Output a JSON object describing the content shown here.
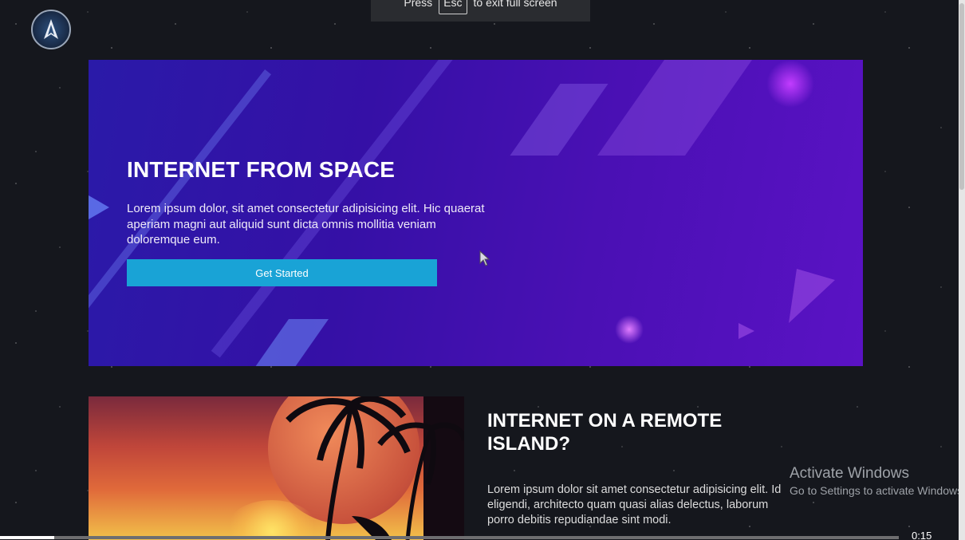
{
  "overlay": {
    "press": "Press",
    "key": "Esc",
    "suffix": "to exit full screen"
  },
  "logo_icon": "shield-rocket-logo",
  "hero": {
    "title": "INTERNET FROM SPACE",
    "text": "Lorem ipsum dolor, sit amet consectetur adipisicing elit. Hic quaerat aperiam magni aut aliquid sunt dicta omnis mollitia veniam doloremque eum.",
    "cta_label": "Get Started",
    "cta_color": "#19a3d6"
  },
  "section": {
    "title": "INTERNET ON A REMOTE ISLAND?",
    "text": "Lorem ipsum dolor sit amet consectetur adipisicing elit. Id eligendi, architecto quam quasi alias delectus, laborum porro debitis repudiandae sint modi."
  },
  "watermark": {
    "line1": "Activate Windows",
    "line2": "Go to Settings to activate Windows."
  },
  "video": {
    "time": "0:15",
    "progress": 0.06
  }
}
